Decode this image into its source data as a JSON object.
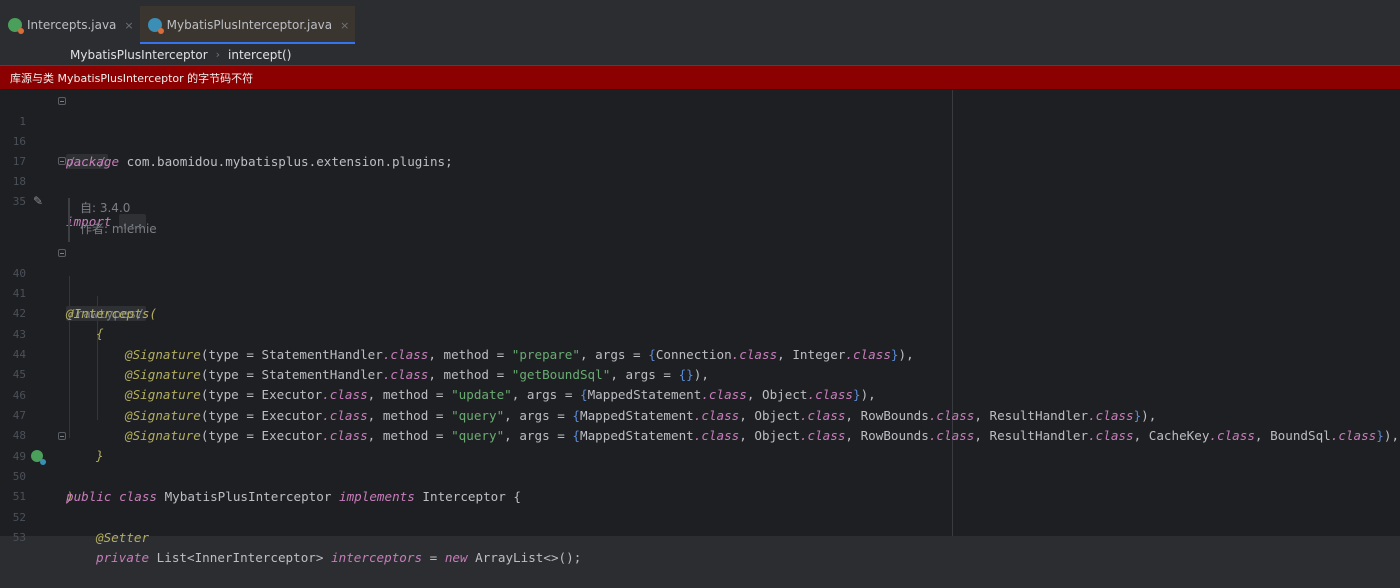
{
  "tabs": [
    {
      "label": "Intercepts.java",
      "close": "×",
      "active": false
    },
    {
      "label": "MybatisPlusInterceptor.java",
      "close": "×",
      "active": true
    }
  ],
  "breadcrumb": {
    "class": "MybatisPlusInterceptor",
    "sep": "›",
    "method": "intercept()"
  },
  "banner": {
    "text": "库源与类 MybatisPlusInterceptor 的字节码不符"
  },
  "doc": {
    "since": "自:    3.4.0",
    "author": "作者: miemie"
  },
  "lines": {
    "n1": "1",
    "n16": "16",
    "n17": "17",
    "n18": "18",
    "n35": "35",
    "n40": "40",
    "n41": "41",
    "n42": "42",
    "n43": "43",
    "n44": "44",
    "n45": "45",
    "n46": "46",
    "n47": "47",
    "n48": "48",
    "n49": "49",
    "n50": "50",
    "n51": "51",
    "n52": "52",
    "n53": "53"
  },
  "code": {
    "l1": "/.../",
    "l16_kw": "package",
    "l16_rest": " com.baomidou.mybatisplus.extension.plugins;",
    "l18_kw": "import",
    "l18_fold": "...",
    "l40": "/rawtypes/",
    "l41_ann": "@Intercepts",
    "l41_rest": "(",
    "l42": "{",
    "sig": "@Signature",
    "type_eq": "(type = ",
    "statement_handler": "StatementHandler",
    "executor": "Executor",
    "dot_class": ".class",
    "method_eq": ", method = ",
    "args_eq": ", args = ",
    "prepare": "\"prepare\"",
    "get_bound_sql": "\"getBoundSql\"",
    "update": "\"update\"",
    "query": "\"query\"",
    "connection": "Connection",
    "integer": "Integer",
    "mapped_statement": "MappedStatement",
    "object": "Object",
    "row_bounds": "RowBounds",
    "result_handler": "ResultHandler",
    "cache_key": "CacheKey",
    "bound_sql": "BoundSql",
    "comma": ", ",
    "open_brace": "{",
    "close_brace": "}",
    "empty_braces": "{}",
    "end_paren_comma": "),",
    "l48": "}",
    "l49": ")",
    "l50_public": "public",
    "l50_class": "class",
    "l50_name": " MybatisPlusInterceptor ",
    "l50_implements": "implements",
    "l50_iface": " Interceptor {",
    "l52_ann": "@Setter",
    "l53_private": "private",
    "l53_type": " List<InnerInterceptor> ",
    "l53_field": "interceptors",
    "l53_eq": " = ",
    "l53_new": "new",
    "l53_rest": " ArrayList<>();"
  }
}
